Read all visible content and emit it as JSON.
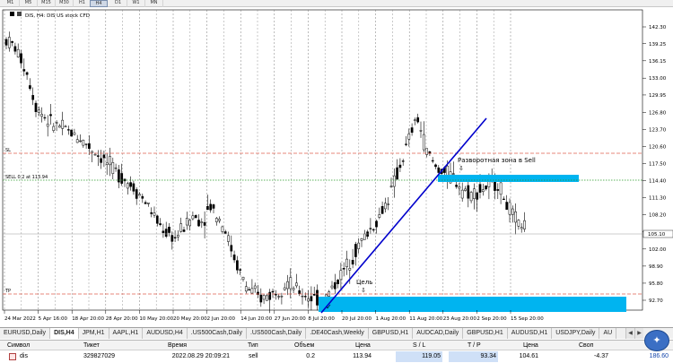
{
  "timeframes": [
    {
      "label": "M1"
    },
    {
      "label": "M5"
    },
    {
      "label": "M15"
    },
    {
      "label": "M30"
    },
    {
      "label": "H1"
    },
    {
      "label": "H4",
      "active": true
    },
    {
      "label": "D1"
    },
    {
      "label": "W1"
    },
    {
      "label": "MN"
    }
  ],
  "chart": {
    "info": "DIS, H4:  DIS US stock CFD",
    "sl_label": "SL",
    "sell_label": "SELL 0.2 at 113.94",
    "tp_label": "TP",
    "zone_label": "Разворотная зона в Sell",
    "target_label": "Цель",
    "price_ticks": [
      "142.30",
      "139.25",
      "136.15",
      "133.00",
      "129.95",
      "126.80",
      "123.70",
      "120.60",
      "117.50",
      "114.40",
      "111.30",
      "108.20",
      "105.10",
      "102.00",
      "98.90",
      "95.80",
      "92.70"
    ],
    "current_price": "105.10",
    "date_ticks": [
      "24 Mar 2022",
      "5 Apr 16:00",
      "18 Apr 20:00",
      "28 Apr 20:00",
      "10 May 20:00",
      "20 May 20:00",
      "2 Jun 20:00",
      "14 Jun 20:00",
      "27 Jun 20:00",
      "8 Jul 20:00",
      "20 Jul 20:00",
      "1 Aug 20:00",
      "11 Aug 20:00",
      "23 Aug 20:00",
      "2 Sep 20:00",
      "15 Sep 20:00"
    ],
    "colors": {
      "grid": "#7a7a7a",
      "candle": "#000000",
      "trendline": "#0000cc",
      "zone": "#00b4f0",
      "sl_line": "#e06050",
      "entry_line": "#2a9a2a",
      "annotation": "#ff2020"
    }
  },
  "tabs": [
    {
      "label": "EURUSD,Daily"
    },
    {
      "label": "DIS,H4",
      "active": true
    },
    {
      "label": "JPM,H1"
    },
    {
      "label": "AAPL,H1"
    },
    {
      "label": "AUDUSD,H4"
    },
    {
      "label": ".US500Cash,Daily"
    },
    {
      "label": ".US500Cash,Daily"
    },
    {
      "label": ".DE40Cash,Weekly"
    },
    {
      "label": "GBPUSD,H1"
    },
    {
      "label": "AUDCAD,Daily"
    },
    {
      "label": "GBPUSD,H1"
    },
    {
      "label": "AUDUSD,H1"
    },
    {
      "label": "USDJPY,Daily"
    },
    {
      "label": "AU"
    }
  ],
  "trade_table": {
    "headers": {
      "symbol": "Символ",
      "ticket": "Тикет",
      "time": "Время",
      "type": "Тип",
      "volume": "Объем",
      "price": "Цена",
      "sl": "S / L",
      "tp": "T / P",
      "price2": "Цена",
      "swap": "Своп"
    },
    "row": {
      "symbol": "dis",
      "ticket": "329827029",
      "time": "2022.08.29 20:09:21",
      "type": "sell",
      "volume": "0.2",
      "price": "113.94",
      "sl": "119.05",
      "tp": "93.34",
      "price2": "104.61",
      "swap": "-4.37",
      "profit": "186.60"
    }
  }
}
